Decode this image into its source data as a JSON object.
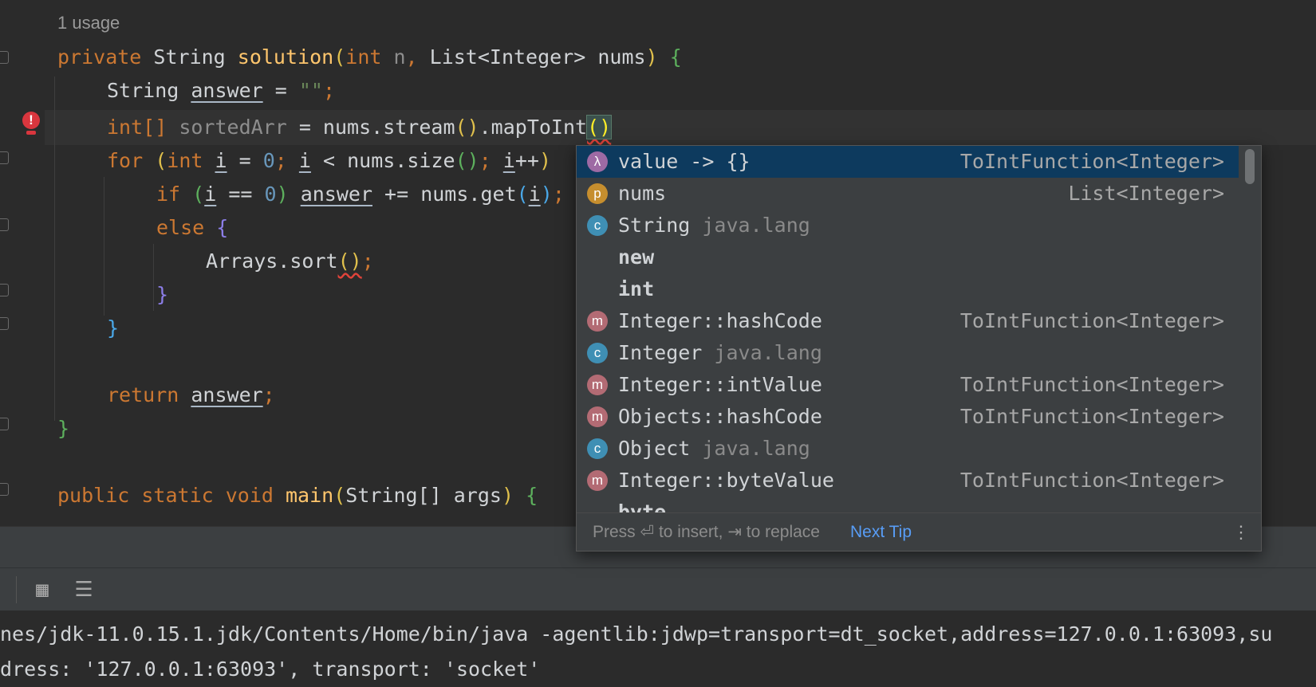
{
  "editor": {
    "usage_hint": "1 usage",
    "lines": {
      "sig": {
        "kw1": "private ",
        "type1": "String ",
        "fn": "solution",
        "open": "(",
        "kw2": "int",
        "p1": " n",
        "comma": ", ",
        "type2": "List<Integer> ",
        "p2": "nums",
        "close": ")",
        "sp": " ",
        "brace": "{"
      },
      "l2": {
        "type": "String ",
        "var": "answer",
        "eq": " = ",
        "str": "\"\"",
        "semi": ";"
      },
      "l3": {
        "type": "int[] ",
        "var": "sortedArr",
        "eq": " = nums.stream",
        "p1": "()",
        "dot": ".mapToInt",
        "p2": "()"
      },
      "l4": {
        "kw": "for ",
        "po": "(",
        "kw2": "int ",
        "i1": "i",
        "eq": " = ",
        "n0": "0",
        "s1": "; ",
        "i2": "i",
        "lt": " < nums.size",
        "pp": "()",
        "s2": "; ",
        "i3": "i",
        "inc": "++",
        "pc": ")"
      },
      "l5": {
        "kw": "if ",
        "po": "(",
        "i": "i",
        "eq": " == ",
        "n0": "0",
        "pc": ")",
        "sp": " ",
        "var": "answer",
        "pe": " += nums.get",
        "go": "(",
        "i2": "i",
        "gc": ")",
        "semi": ";"
      },
      "l6": {
        "kw": "else ",
        "brace": "{"
      },
      "l7": {
        "call": "Arrays.sort",
        "p": "()",
        "semi": ";"
      },
      "l8": {
        "brace": "}"
      },
      "l9": {
        "brace": "}"
      },
      "l10": {
        "kw": "return ",
        "var": "answer",
        "semi": ";"
      },
      "l11": {
        "brace": "}"
      },
      "l12": {
        "kw": "public static void ",
        "fn": "main",
        "po": "(",
        "type": "String[] args",
        "pc": ")",
        "sp": " ",
        "brace": "{"
      }
    },
    "error_marker": "!"
  },
  "completion": {
    "items": [
      {
        "icon": "λ",
        "icon_name": "lambda-icon",
        "name": "value -> {}",
        "pkg": "",
        "type": "ToIntFunction<Integer>",
        "selected": true
      },
      {
        "icon": "p",
        "icon_name": "parameter-icon",
        "name": "nums",
        "pkg": "",
        "type": "List<Integer>"
      },
      {
        "icon": "c",
        "icon_name": "class-icon",
        "name": "String",
        "pkg": " java.lang",
        "type": ""
      },
      {
        "icon": "",
        "icon_name": "",
        "name": "new",
        "pkg": "",
        "type": "",
        "bold": true
      },
      {
        "icon": "",
        "icon_name": "",
        "name": "int",
        "pkg": "",
        "type": "",
        "bold": true
      },
      {
        "icon": "m",
        "icon_name": "method-icon",
        "name": "Integer::hashCode",
        "pkg": "",
        "type": "ToIntFunction<Integer>"
      },
      {
        "icon": "c",
        "icon_name": "class-icon",
        "name": "Integer",
        "pkg": " java.lang",
        "type": ""
      },
      {
        "icon": "m",
        "icon_name": "method-icon",
        "name": "Integer::intValue",
        "pkg": "",
        "type": "ToIntFunction<Integer>"
      },
      {
        "icon": "m",
        "icon_name": "method-icon",
        "name": "Objects::hashCode",
        "pkg": "",
        "type": "ToIntFunction<Integer>"
      },
      {
        "icon": "c",
        "icon_name": "class-icon",
        "name": "Object",
        "pkg": " java.lang",
        "type": ""
      },
      {
        "icon": "m",
        "icon_name": "method-icon",
        "name": "Integer::byteValue",
        "pkg": "",
        "type": "ToIntFunction<Integer>"
      },
      {
        "icon": "",
        "icon_name": "",
        "name": "byte",
        "pkg": "",
        "type": "",
        "bold": true
      }
    ],
    "hint": "Press ⏎ to insert, ⇥ to replace",
    "next_tip": "Next Tip",
    "more": "⋮"
  },
  "console": {
    "line1": "nes/jdk-11.0.15.1.jdk/Contents/Home/bin/java -agentlib:jdwp=transport=dt_socket,address=127.0.0.1:63093,su",
    "line2": "dress: '127.0.0.1:63093', transport: 'socket'"
  },
  "toolbar": {
    "table_icon": "▦",
    "settings_icon": "☰"
  },
  "colors": {
    "background": "#2b2b2b",
    "keyword": "#cc7832",
    "function": "#ffc66d",
    "selection": "#0d3a5e",
    "link": "#589df6"
  }
}
